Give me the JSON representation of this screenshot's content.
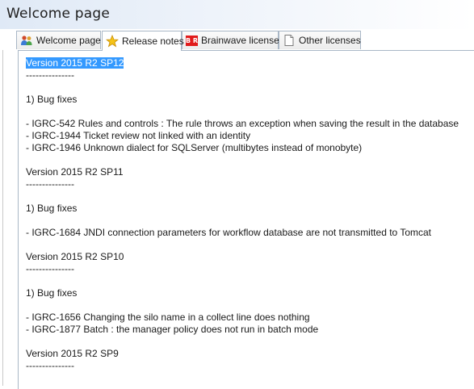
{
  "window": {
    "title": "Welcome page"
  },
  "tabs": [
    {
      "label": "Welcome page",
      "icon": "people-icon"
    },
    {
      "label": "Release notes",
      "icon": "star-icon",
      "active": true
    },
    {
      "label": "Brainwave license",
      "icon": "brainwave-logo-icon",
      "logo_text": "B R"
    },
    {
      "label": "Other licenses",
      "icon": "document-icon"
    }
  ],
  "release_notes": {
    "selected_text": "Version 2015 R2 SP12",
    "lines": [
      "---------------",
      "",
      "1) Bug fixes",
      "",
      "- IGRC-542 Rules and controls : The rule throws an exception when saving the result in the database",
      "- IGRC-1944 Ticket review not linked with an identity",
      "- IGRC-1946 Unknown dialect for SQLServer (multibytes instead of monobyte)",
      "",
      "Version 2015 R2 SP11",
      "---------------",
      "",
      "1) Bug fixes",
      "",
      "- IGRC-1684 JNDI connection parameters for workflow database are not transmitted to Tomcat",
      "",
      "Version 2015 R2 SP10",
      "---------------",
      "",
      "1) Bug fixes",
      "",
      "- IGRC-1656 Changing the silo name in a collect line does nothing",
      "- IGRC-1877 Batch : the manager policy does not run in batch mode",
      "",
      "Version 2015 R2 SP9",
      "---------------"
    ]
  }
}
